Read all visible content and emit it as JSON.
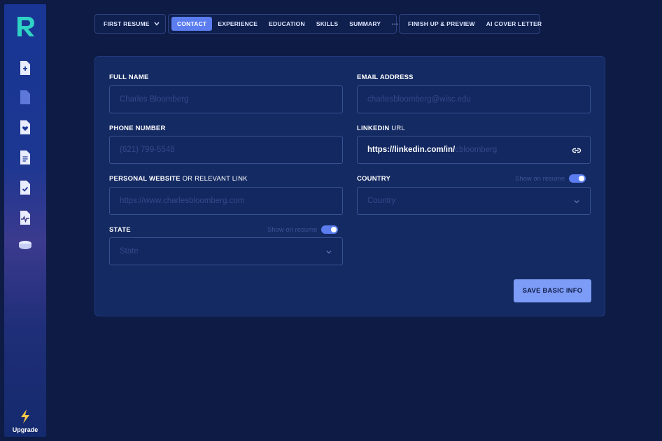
{
  "sidebar": {
    "items": [
      {
        "icon": "file-plus-icon"
      },
      {
        "icon": "file-icon"
      },
      {
        "icon": "file-heart-icon"
      },
      {
        "icon": "file-text-icon"
      },
      {
        "icon": "file-check-icon"
      },
      {
        "icon": "file-pulse-icon"
      },
      {
        "icon": "coins-icon"
      }
    ],
    "upgrade_label": "Upgrade"
  },
  "nav": {
    "resume_selector": "FIRST RESUME",
    "tabs": [
      {
        "label": "CONTACT",
        "active": true
      },
      {
        "label": "EXPERIENCE"
      },
      {
        "label": "EDUCATION"
      },
      {
        "label": "SKILLS"
      },
      {
        "label": "SUMMARY"
      },
      {
        "label": "···"
      }
    ],
    "actions": [
      {
        "label": "FINISH UP & PREVIEW"
      },
      {
        "label": "AI COVER LETTER"
      }
    ]
  },
  "form": {
    "full_name": {
      "label": "FULL NAME",
      "placeholder": "Charles Bloomberg"
    },
    "email": {
      "label": "EMAIL ADDRESS",
      "placeholder": "charlesbloomberg@wisc.edu"
    },
    "phone": {
      "label": "PHONE NUMBER",
      "placeholder": "(621) 799-5548"
    },
    "linkedin": {
      "label_bold": "LINKEDIN",
      "label_light": " URL",
      "value": "https://linkedin.com/in/",
      "placeholder": "cbloomberg"
    },
    "website": {
      "label_bold": "PERSONAL WEBSITE",
      "label_light": " OR RELEVANT LINK",
      "placeholder": "https://www.charlesbloomberg.com"
    },
    "country": {
      "label": "COUNTRY",
      "placeholder": "Country",
      "toggle_label": "Show on resume"
    },
    "state": {
      "label": "STATE",
      "placeholder": "State",
      "toggle_label": "Show on resume"
    },
    "save_label": "SAVE BASIC INFO"
  },
  "colors": {
    "accent": "#5b7df0",
    "background": "#0d1b45",
    "card": "#142a63",
    "button": "#7d9cf7"
  }
}
